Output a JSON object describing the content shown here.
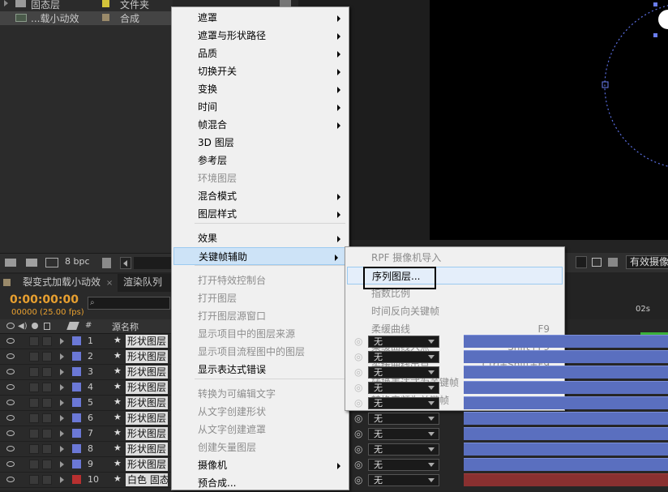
{
  "project": {
    "items": [
      {
        "name": "固态层",
        "type": "文件夹",
        "color": "#d4c43a"
      },
      {
        "name": "...载小动效",
        "type": "合成",
        "color": "#9a8a6a"
      }
    ],
    "bpc": "8 bpc"
  },
  "timeline": {
    "tabs": [
      "裂变式加载小动效",
      "渲染队列"
    ],
    "timecode": "0:00:00:00",
    "fps": "00000 (25.00 fps)",
    "search_placeholder": "",
    "col_source": "源名称",
    "col_num": "#",
    "time_marker": "02s",
    "layers": [
      {
        "num": "1",
        "name": "形状图层",
        "color": "#6b78d6",
        "mode": "无"
      },
      {
        "num": "2",
        "name": "形状图层",
        "color": "#6b78d6",
        "mode": "无"
      },
      {
        "num": "3",
        "name": "形状图层",
        "color": "#6b78d6",
        "mode": "无"
      },
      {
        "num": "4",
        "name": "形状图层",
        "color": "#6b78d6",
        "mode": "无"
      },
      {
        "num": "5",
        "name": "形状图层",
        "color": "#6b78d6",
        "mode": "无"
      },
      {
        "num": "6",
        "name": "形状图层",
        "color": "#6b78d6",
        "mode": "无"
      },
      {
        "num": "7",
        "name": "形状图层",
        "color": "#6b78d6",
        "mode": "无"
      },
      {
        "num": "8",
        "name": "形状图层",
        "color": "#6b78d6",
        "mode": "无"
      },
      {
        "num": "9",
        "name": "形状图层",
        "color": "#6b78d6",
        "mode": "无"
      },
      {
        "num": "10",
        "name": "白色 固态",
        "color": "#b83030",
        "mode": "无"
      }
    ]
  },
  "viewer": {
    "camera_label": "有效摄像"
  },
  "context_menu": {
    "items": [
      {
        "label": "遮罩",
        "sub": true
      },
      {
        "label": "遮罩与形状路径",
        "sub": true
      },
      {
        "label": "品质",
        "sub": true
      },
      {
        "label": "切换开关",
        "sub": true
      },
      {
        "label": "变换",
        "sub": true
      },
      {
        "label": "时间",
        "sub": true
      },
      {
        "label": "帧混合",
        "sub": true
      },
      {
        "label": "3D 图层",
        "sub": false
      },
      {
        "label": "参考层",
        "sub": false
      },
      {
        "label": "环境图层",
        "sub": false,
        "disabled": true
      },
      {
        "label": "混合模式",
        "sub": true
      },
      {
        "label": "图层样式",
        "sub": true
      },
      {
        "label": "效果",
        "sub": true
      },
      {
        "label": "关键帧辅助",
        "sub": true,
        "highlighted": true
      },
      {
        "label": "打开特效控制台",
        "disabled": true
      },
      {
        "label": "打开图层",
        "disabled": true
      },
      {
        "label": "打开图层源窗口",
        "disabled": true
      },
      {
        "label": "显示项目中的图层来源",
        "disabled": true
      },
      {
        "label": "显示项目流程图中的图层",
        "disabled": true
      },
      {
        "label": "显示表达式错误",
        "disabled": false
      },
      {
        "label": "转换为可编辑文字",
        "disabled": true
      },
      {
        "label": "从文字创建形状",
        "disabled": true
      },
      {
        "label": "从文字创建遮罩",
        "disabled": true
      },
      {
        "label": "创建矢量图层",
        "disabled": true
      },
      {
        "label": "摄像机",
        "sub": true
      },
      {
        "label": "预合成..."
      }
    ]
  },
  "submenu": {
    "items": [
      {
        "label": "RPF 摄像机导入",
        "disabled": true,
        "shortcut": ""
      },
      {
        "label": "序列图层...",
        "disabled": false,
        "shortcut": "",
        "highlighted": true
      },
      {
        "label": "指数比例",
        "disabled": true,
        "shortcut": ""
      },
      {
        "label": "时间反向关键帧",
        "disabled": true,
        "shortcut": ""
      },
      {
        "label": "柔缓曲线",
        "disabled": true,
        "shortcut": "F9"
      },
      {
        "label": "柔缓曲线入点",
        "disabled": true,
        "shortcut": "Shift+F9"
      },
      {
        "label": "柔缓曲线出点",
        "disabled": true,
        "shortcut": "Ctrl+Shift+F9"
      },
      {
        "label": "转换表达式为关键帧",
        "disabled": true,
        "shortcut": ""
      },
      {
        "label": "转换音频为关键帧",
        "disabled": true,
        "shortcut": ""
      }
    ]
  }
}
